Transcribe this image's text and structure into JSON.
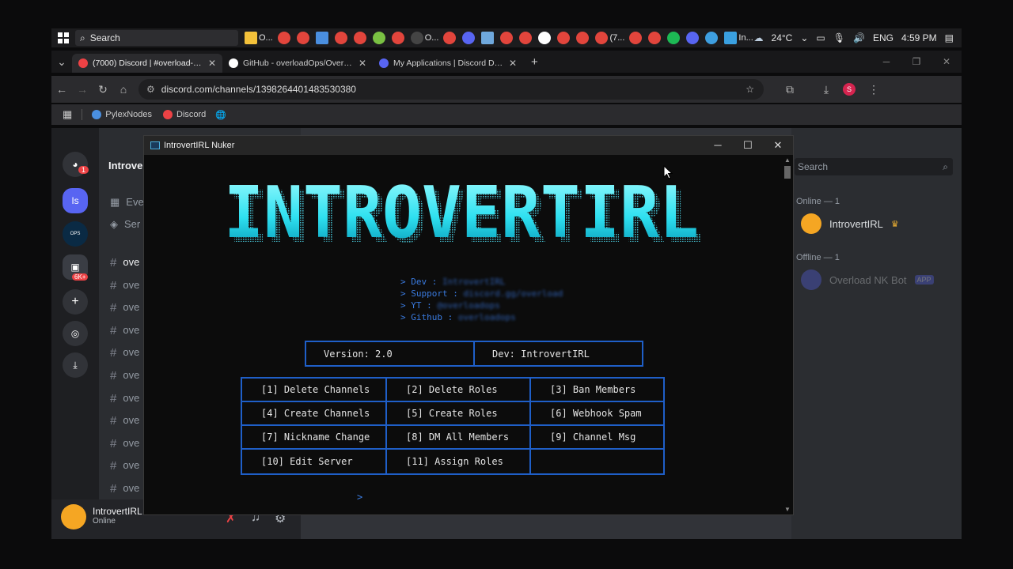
{
  "taskbar": {
    "search_label": "Search",
    "pinned": [
      {
        "label": "O...",
        "icon": "folder-icon",
        "color": "#f3c13a"
      },
      {
        "label": "",
        "icon": "chrome-icon",
        "color": "#e2453c"
      },
      {
        "label": "",
        "icon": "chrome-icon",
        "color": "#e2453c"
      },
      {
        "label": "",
        "icon": "notepad-icon",
        "color": "#4a8fe0"
      },
      {
        "label": "",
        "icon": "chrome-icon",
        "color": "#e2453c"
      },
      {
        "label": "",
        "icon": "chrome-icon",
        "color": "#e2453c"
      },
      {
        "label": "",
        "icon": "android-icon",
        "color": "#7ac143"
      },
      {
        "label": "",
        "icon": "chrome-icon",
        "color": "#e2453c"
      },
      {
        "label": "O...",
        "icon": "obs-icon",
        "color": "#444"
      },
      {
        "label": "",
        "icon": "chrome-icon",
        "color": "#e2453c"
      },
      {
        "label": "",
        "icon": "discord-icon",
        "color": "#5865f2"
      },
      {
        "label": "",
        "icon": "file-icon",
        "color": "#6fa8dc"
      },
      {
        "label": "",
        "icon": "chrome-icon",
        "color": "#e2453c"
      },
      {
        "label": "",
        "icon": "chrome-icon",
        "color": "#e2453c"
      },
      {
        "label": "",
        "icon": "github-icon",
        "color": "#ffffff"
      },
      {
        "label": "",
        "icon": "chrome-icon",
        "color": "#e2453c"
      },
      {
        "label": "",
        "icon": "chrome-icon",
        "color": "#e2453c"
      },
      {
        "label": "(7...",
        "icon": "chrome-icon",
        "color": "#e2453c"
      },
      {
        "label": "",
        "icon": "chrome-icon",
        "color": "#e2453c"
      },
      {
        "label": "",
        "icon": "chrome-icon",
        "color": "#e2453c"
      },
      {
        "label": "",
        "icon": "spotify-icon",
        "color": "#1db954"
      },
      {
        "label": "",
        "icon": "discord-icon",
        "color": "#5865f2"
      },
      {
        "label": "",
        "icon": "vscode-icon",
        "color": "#3e9fe0"
      },
      {
        "label": "In...",
        "icon": "terminal-icon",
        "color": "#3aa0e0"
      }
    ],
    "weather": "24°C",
    "language": "ENG",
    "time": "4:59 PM"
  },
  "browser": {
    "tabs": [
      {
        "title": "(7000) Discord | #overload-ops",
        "favicon_color": "#ed4245",
        "active": true
      },
      {
        "title": "GitHub - overloadOps/Overload",
        "favicon_color": "#ffffff",
        "active": false
      },
      {
        "title": "My Applications | Discord Deve",
        "favicon_color": "#5865f2",
        "active": false
      }
    ],
    "new_tab": "+",
    "url": "discord.com/channels/1398264401483530380",
    "profile_initial": "S",
    "bookmarks": [
      {
        "label": "PylexNodes",
        "color": "#4a8fe0"
      },
      {
        "label": "Discord",
        "color": "#ed4245"
      }
    ]
  },
  "discord": {
    "server_initial": "Is",
    "server_badge": "1",
    "folder_badge": "6K+",
    "server_name": "Introve",
    "nav_items": [
      "Eve",
      "Ser"
    ],
    "channels": [
      "ove",
      "ove",
      "ove",
      "ove",
      "ove",
      "ove",
      "ove",
      "ove",
      "ove",
      "ove",
      "ove"
    ],
    "user": {
      "name": "IntrovertIRL",
      "status": "Online"
    },
    "search_placeholder": "Search",
    "members": {
      "online_header": "Online — 1",
      "online": [
        {
          "name": "IntrovertIRL"
        }
      ],
      "offline_header": "Offline — 1",
      "offline": [
        {
          "name": "Overload NK Bot",
          "tag": "APP"
        }
      ]
    }
  },
  "nuker": {
    "window_title": "IntrovertIRL Nuker",
    "banner_text": "INTROVERTIRL",
    "info_lines": [
      {
        "label": "> Dev : ",
        "value": "IntrovertIRL"
      },
      {
        "label": "> Support : ",
        "value": "discord.gg/overload"
      },
      {
        "label": "> YT : ",
        "value": "@overloadops"
      },
      {
        "label": "> Github : ",
        "value": "overloadops"
      }
    ],
    "version_label": "Version: 2.0",
    "dev_label": "Dev: IntrovertIRL",
    "options": [
      "[1] Delete Channels",
      "[2] Delete Roles",
      "[3] Ban Members",
      "[4] Create Channels",
      "[5] Create Roles",
      "[6] Webhook Spam",
      "[7] Nickname Change",
      "[8] DM All Members",
      "[9] Channel Msg",
      "[10] Edit Server",
      "[11] Assign Roles",
      ""
    ],
    "prompt": ">",
    "colors": {
      "accent": "#1f5fc8",
      "banner_top": "#7ff6ff",
      "banner_bottom": "#00b5cc"
    }
  }
}
